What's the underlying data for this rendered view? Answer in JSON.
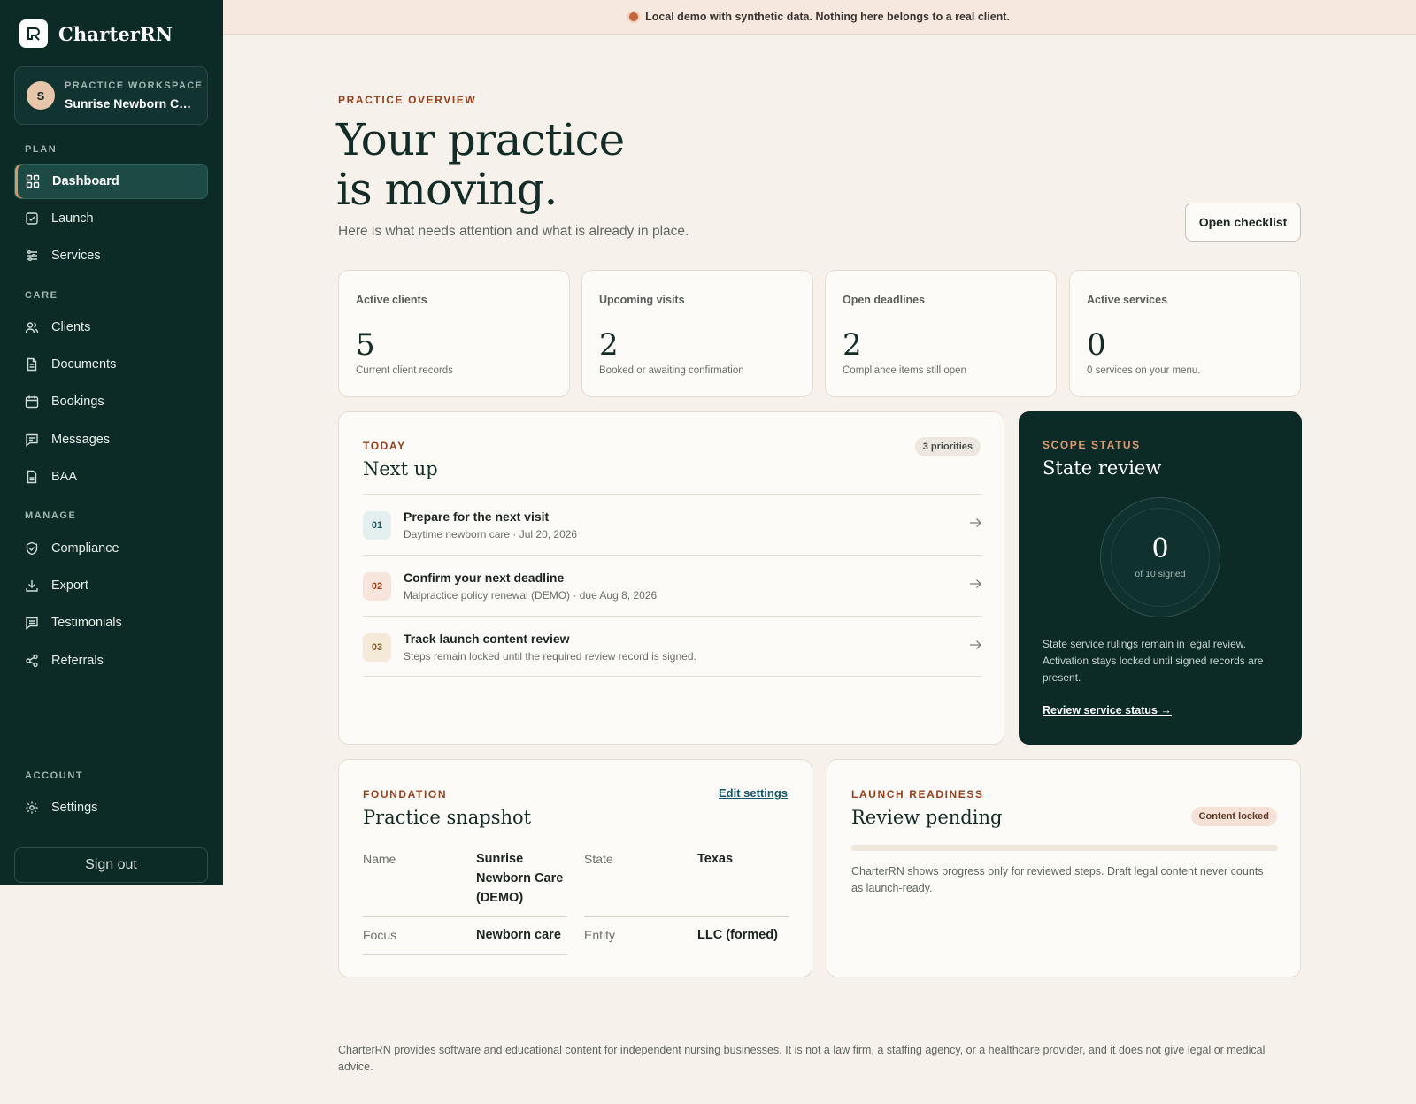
{
  "brand": {
    "name": "CharterRN"
  },
  "workspace": {
    "label": "PRACTICE WORKSPACE",
    "name": "Sunrise Newborn Car...",
    "initial": "S"
  },
  "nav": {
    "sections": {
      "plan": "PLAN",
      "care": "CARE",
      "manage": "MANAGE",
      "account": "ACCOUNT"
    },
    "items": [
      {
        "label": "Dashboard",
        "icon": "grid-icon",
        "active": true
      },
      {
        "label": "Launch",
        "icon": "checkbox-icon"
      },
      {
        "label": "Services",
        "icon": "sliders-icon"
      },
      {
        "label": "Clients",
        "icon": "users-icon"
      },
      {
        "label": "Documents",
        "icon": "document-icon"
      },
      {
        "label": "Bookings",
        "icon": "calendar-icon"
      },
      {
        "label": "Messages",
        "icon": "message-icon"
      },
      {
        "label": "BAA",
        "icon": "file-icon"
      },
      {
        "label": "Compliance",
        "icon": "shield-icon"
      },
      {
        "label": "Export",
        "icon": "download-icon"
      },
      {
        "label": "Testimonials",
        "icon": "quote-icon"
      },
      {
        "label": "Referrals",
        "icon": "share-icon"
      },
      {
        "label": "Settings",
        "icon": "gear-icon"
      }
    ],
    "sign_out": "Sign out"
  },
  "banner": {
    "text": "Local demo with synthetic data. Nothing here belongs to a real client."
  },
  "header": {
    "eyebrow": "PRACTICE OVERVIEW",
    "title_line1": "Your practice",
    "title_line2": "is moving.",
    "subtitle": "Here is what needs attention and what is already in place.",
    "checklist_button": "Open checklist"
  },
  "stats": [
    {
      "label": "Active clients",
      "value": "5",
      "note": "Current client records"
    },
    {
      "label": "Upcoming visits",
      "value": "2",
      "note": "Booked or awaiting confirmation"
    },
    {
      "label": "Open deadlines",
      "value": "2",
      "note": "Compliance items still open"
    },
    {
      "label": "Active services",
      "value": "0",
      "note": "0 services on your menu."
    }
  ],
  "next_up": {
    "eyebrow": "TODAY",
    "title": "Next up",
    "badge": "3 priorities",
    "tasks": [
      {
        "num": "01",
        "title": "Prepare for the next visit",
        "sub": "Daytime newborn care · Jul 20, 2026",
        "color": "#e3f0ef",
        "text_color": "#1f5a5e"
      },
      {
        "num": "02",
        "title": "Confirm your next deadline",
        "sub": "Malpractice policy renewal (DEMO) · due Aug 8, 2026",
        "color": "#f7e4da",
        "text_color": "#9a3f1c"
      },
      {
        "num": "03",
        "title": "Track launch content review",
        "sub": "Steps remain locked until the required review record is signed.",
        "color": "#f5ead8",
        "text_color": "#7a5a22"
      }
    ]
  },
  "scope": {
    "eyebrow": "SCOPE STATUS",
    "title": "State review",
    "value": "0",
    "value_sub": "of 10 signed",
    "signed": 0,
    "total": 10,
    "text": "State service rulings remain in legal review. Activation stays locked until signed records are present.",
    "link": "Review service status →"
  },
  "snapshot": {
    "eyebrow": "FOUNDATION",
    "title": "Practice snapshot",
    "edit": "Edit settings",
    "fields": {
      "name_label": "Name",
      "name_value": "Sunrise Newborn Care (DEMO)",
      "state_label": "State",
      "state_value": "Texas",
      "focus_label": "Focus",
      "focus_value": "Newborn care",
      "entity_label": "Entity",
      "entity_value": "LLC (formed)"
    }
  },
  "readiness": {
    "eyebrow": "LAUNCH READINESS",
    "title": "Review pending",
    "badge": "Content locked",
    "progress": 0,
    "text": "CharterRN shows progress only for reviewed steps. Draft legal content never counts as launch-ready."
  },
  "footer": {
    "text": "CharterRN provides software and educational content for independent nursing businesses. It is not a law firm, a staffing agency, or a healthcare provider, and it does not give legal or medical advice."
  },
  "colors": {
    "sidebar": "#0c2b27",
    "accent": "#9a3f1c",
    "background": "#f6f1ea"
  }
}
